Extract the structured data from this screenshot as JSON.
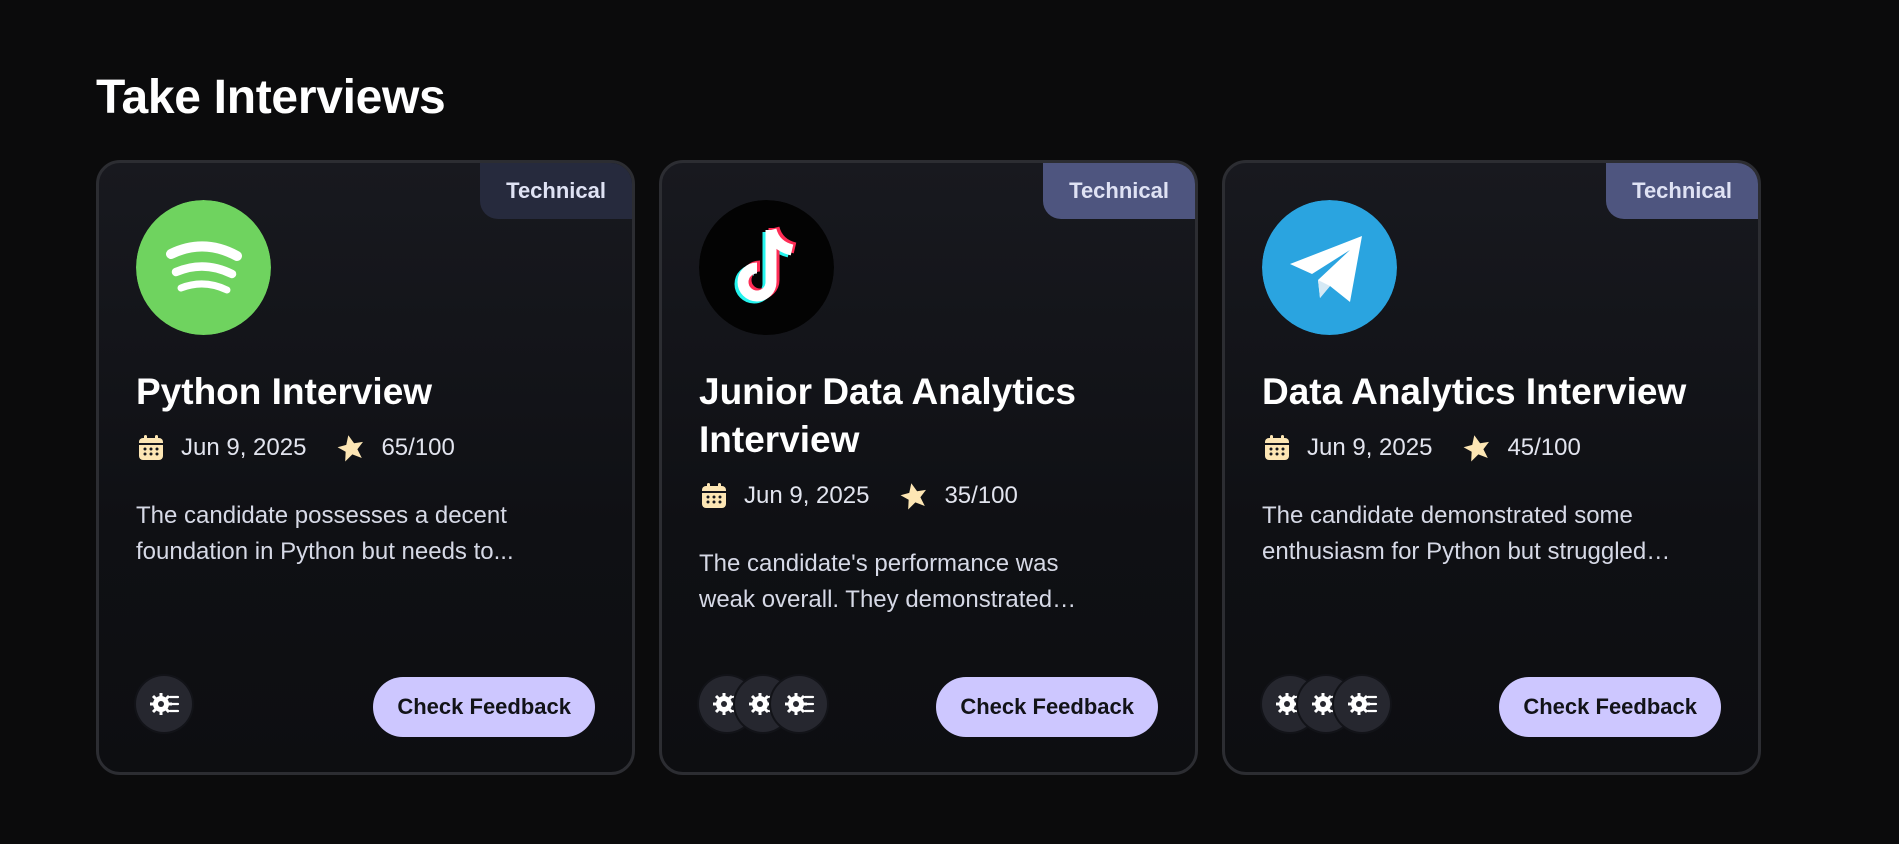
{
  "section": {
    "title": "Take Interviews"
  },
  "cards": [
    {
      "type_tag": "Technical",
      "logo": "spotify-logo",
      "title": "Python Interview",
      "date": "Jun 9, 2025",
      "score": "65/100",
      "summary": "The candidate possesses a decent foundation in Python but needs to...",
      "tech_icon_count": 1,
      "button_label": "Check Feedback"
    },
    {
      "type_tag": "Technical",
      "logo": "tiktok-logo",
      "title": "Junior Data Analytics Interview",
      "date": "Jun 9, 2025",
      "score": "35/100",
      "summary": "The candidate's performance was weak overall. They demonstrated limited...",
      "tech_icon_count": 3,
      "button_label": "Check Feedback"
    },
    {
      "type_tag": "Technical",
      "logo": "telegram-logo",
      "title": "Data Analytics Interview",
      "date": "Jun 9, 2025",
      "score": "45/100",
      "summary": "The candidate demonstrated some enthusiasm for Python but struggled wit...",
      "tech_icon_count": 3,
      "button_label": "Check Feedback"
    }
  ],
  "icons": {
    "date": "calendar-icon",
    "score": "star-icon",
    "tech": "gear-icon"
  },
  "colors": {
    "background": "#0b0b0c",
    "card_border": "#2c2d32",
    "button": "#cdc7ff",
    "icon_accent": "#fde6b4",
    "spotify_green": "#6fd35f",
    "telegram_blue": "#2aa4e0"
  }
}
